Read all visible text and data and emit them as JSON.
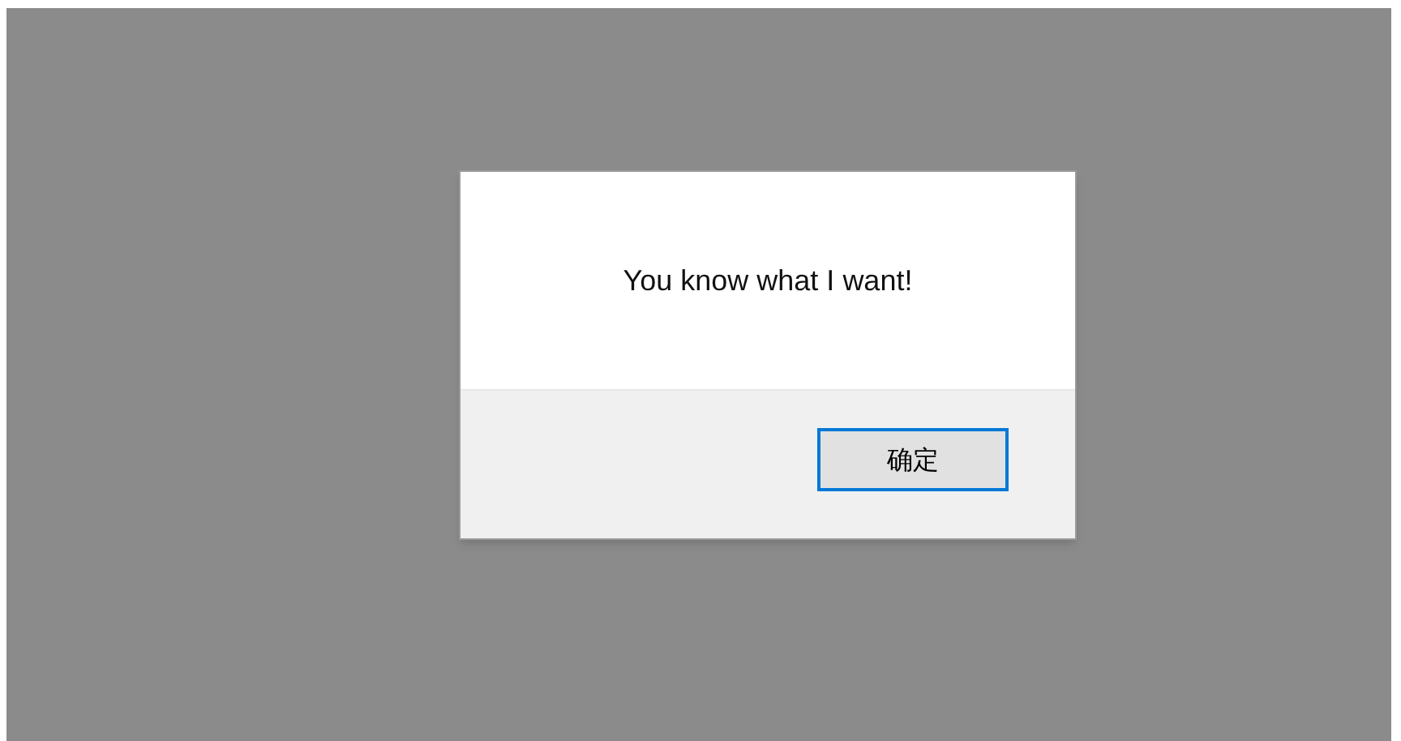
{
  "dialog": {
    "message": "You know what I want!",
    "buttons": [
      {
        "label": "确定",
        "focused": true
      }
    ]
  }
}
